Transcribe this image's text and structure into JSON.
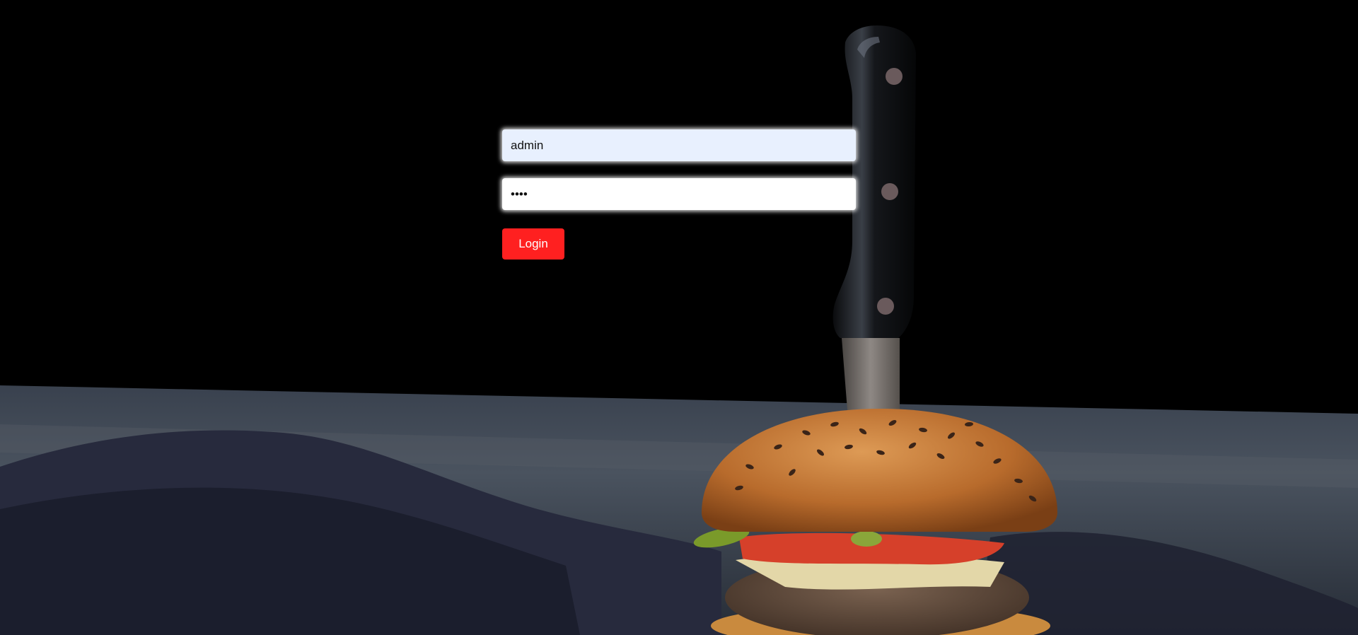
{
  "login": {
    "username_value": "admin",
    "password_value": "••••",
    "button_label": "Login"
  },
  "background": {
    "subject": "burger-with-knife",
    "colors": {
      "backdrop": "#000000",
      "table": "#3a4350",
      "cloth": "#2a2c40",
      "bun": "#c57a36",
      "tomato": "#d6402a",
      "patty": "#5a4536",
      "knife_handle": "#121417",
      "knife_blade": "#7d7773"
    }
  },
  "colors": {
    "button": "#ff2020",
    "username_bg": "#e8f0fe",
    "password_bg": "#ffffff"
  }
}
